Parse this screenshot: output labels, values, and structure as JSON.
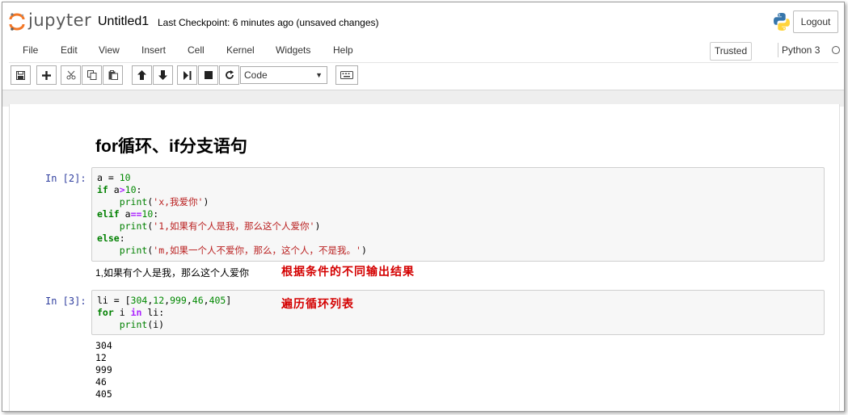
{
  "header": {
    "logo_text": "jupyter",
    "notebook_title": "Untitled1",
    "checkpoint": "Last Checkpoint: 6 minutes ago (unsaved changes)",
    "logout_label": "Logout"
  },
  "menu": {
    "items": [
      "File",
      "Edit",
      "View",
      "Insert",
      "Cell",
      "Kernel",
      "Widgets",
      "Help"
    ],
    "trusted_label": "Trusted",
    "kernel_name": "Python 3"
  },
  "toolbar": {
    "cell_type": "Code",
    "buttons": [
      "save-icon",
      "plus-icon",
      "cut-icon",
      "copy-icon",
      "paste-icon",
      "arrow-up-icon",
      "arrow-down-icon",
      "run-icon",
      "stop-icon",
      "restart-icon",
      "keyboard-icon"
    ]
  },
  "cells": {
    "heading": "for循环、if分支语句",
    "cell1": {
      "prompt": "In  [2]:",
      "output": "1,如果有个人是我，那么这个人爱你",
      "annotation": "根据条件的不同输出结果"
    },
    "cell2": {
      "prompt": "In  [3]:",
      "annotation": "遍历循环列表",
      "outputs": [
        "304",
        "12",
        "999",
        "46",
        "405"
      ]
    }
  },
  "colors": {
    "prompt": "#303f9f",
    "keyword": "#008000",
    "string": "#ba2121",
    "annotation": "#d40000"
  }
}
